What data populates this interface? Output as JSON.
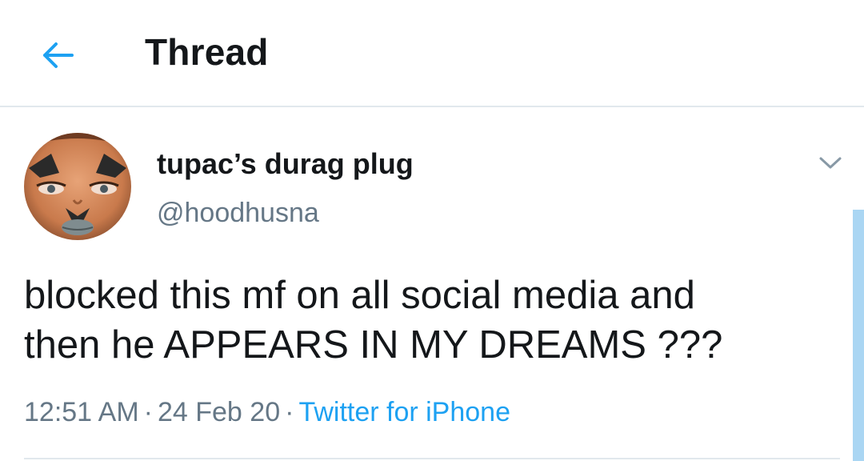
{
  "header": {
    "back_icon": "arrow-left-icon",
    "title": "Thread"
  },
  "tweet": {
    "author": {
      "display_name": "tupac’s durag plug",
      "handle": "@hoodhusna",
      "avatar": "profile-photo"
    },
    "menu_icon": "chevron-down-icon",
    "text_lines": [
      "blocked this mf on all social media and",
      "then he APPEARS IN MY DREAMS ???"
    ],
    "time": "12:51 AM",
    "date": "24 Feb 20",
    "separator": "·",
    "source": "Twitter for iPhone"
  },
  "colors": {
    "accent": "#1da1f2",
    "text": "#14171a",
    "secondary_text": "#657786",
    "divider": "#e1e8ed"
  }
}
